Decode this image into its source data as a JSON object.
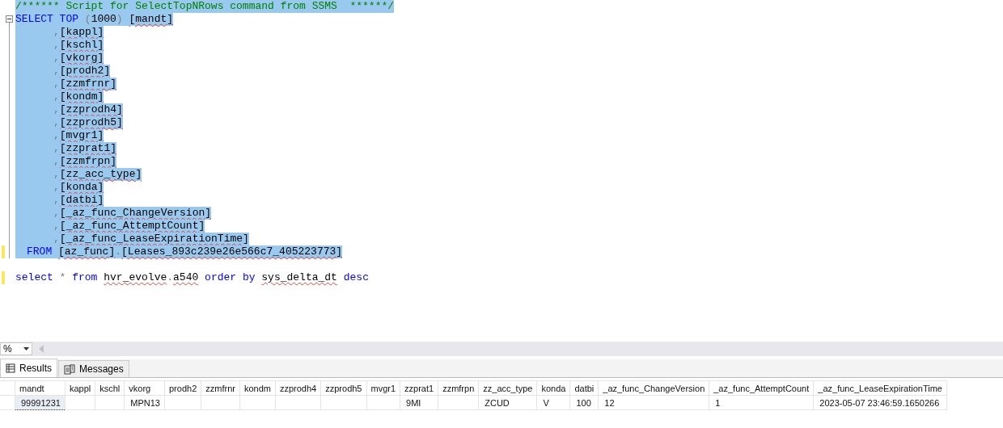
{
  "editor": {
    "lines": [
      {
        "kind": "code",
        "selected": true,
        "segments": [
          {
            "kind": "comment",
            "text": "/****** Script for SelectTopNRows command from SSMS  ******/"
          }
        ]
      },
      {
        "kind": "code",
        "selected": true,
        "collapsible": true,
        "segments": [
          {
            "kind": "keyword",
            "text": "SELECT "
          },
          {
            "kind": "keyword",
            "text": "TOP"
          },
          {
            "kind": "gray",
            "text": " ("
          },
          {
            "kind": "plain",
            "text": "1000"
          },
          {
            "kind": "gray",
            "text": ") "
          },
          {
            "kind": "plain",
            "text": "[mandt]",
            "squiggle": true
          }
        ]
      },
      {
        "kind": "column",
        "selected": true,
        "segments": [
          {
            "kind": "gray",
            "text": ","
          },
          {
            "kind": "plain",
            "text": "[kappl]",
            "squiggle": true
          }
        ]
      },
      {
        "kind": "column",
        "selected": true,
        "segments": [
          {
            "kind": "gray",
            "text": ","
          },
          {
            "kind": "plain",
            "text": "[kschl]",
            "squiggle": true
          }
        ]
      },
      {
        "kind": "column",
        "selected": true,
        "segments": [
          {
            "kind": "gray",
            "text": ","
          },
          {
            "kind": "plain",
            "text": "[vkorg]",
            "squiggle": true
          }
        ]
      },
      {
        "kind": "column",
        "selected": true,
        "segments": [
          {
            "kind": "gray",
            "text": ","
          },
          {
            "kind": "plain",
            "text": "[prodh2]",
            "squiggle": true
          }
        ]
      },
      {
        "kind": "column",
        "selected": true,
        "segments": [
          {
            "kind": "gray",
            "text": ","
          },
          {
            "kind": "plain",
            "text": "[zzmfrnr]",
            "squiggle": true
          }
        ]
      },
      {
        "kind": "column",
        "selected": true,
        "segments": [
          {
            "kind": "gray",
            "text": ","
          },
          {
            "kind": "plain",
            "text": "[kondm]",
            "squiggle": true
          }
        ]
      },
      {
        "kind": "column",
        "selected": true,
        "segments": [
          {
            "kind": "gray",
            "text": ","
          },
          {
            "kind": "plain",
            "text": "[zzprodh4]",
            "squiggle": true
          }
        ]
      },
      {
        "kind": "column",
        "selected": true,
        "segments": [
          {
            "kind": "gray",
            "text": ","
          },
          {
            "kind": "plain",
            "text": "[zzprodh5]",
            "squiggle": true
          }
        ]
      },
      {
        "kind": "column",
        "selected": true,
        "segments": [
          {
            "kind": "gray",
            "text": ","
          },
          {
            "kind": "plain",
            "text": "[mvgr1]",
            "squiggle": true
          }
        ]
      },
      {
        "kind": "column",
        "selected": true,
        "segments": [
          {
            "kind": "gray",
            "text": ","
          },
          {
            "kind": "plain",
            "text": "[zzprat1]",
            "squiggle": true
          }
        ]
      },
      {
        "kind": "column",
        "selected": true,
        "segments": [
          {
            "kind": "gray",
            "text": ","
          },
          {
            "kind": "plain",
            "text": "[zzmfrpn]",
            "squiggle": true
          }
        ]
      },
      {
        "kind": "column",
        "selected": true,
        "segments": [
          {
            "kind": "gray",
            "text": ","
          },
          {
            "kind": "plain",
            "text": "[zz_acc_type]",
            "squiggle": true
          }
        ]
      },
      {
        "kind": "column",
        "selected": true,
        "segments": [
          {
            "kind": "gray",
            "text": ","
          },
          {
            "kind": "plain",
            "text": "[konda]",
            "squiggle": true
          }
        ]
      },
      {
        "kind": "column",
        "selected": true,
        "segments": [
          {
            "kind": "gray",
            "text": ","
          },
          {
            "kind": "plain",
            "text": "[datbi]",
            "squiggle": true
          }
        ]
      },
      {
        "kind": "column",
        "selected": true,
        "segments": [
          {
            "kind": "gray",
            "text": ","
          },
          {
            "kind": "plain",
            "text": "[_az_func_ChangeVersion]",
            "squiggle": true
          }
        ]
      },
      {
        "kind": "column",
        "selected": true,
        "segments": [
          {
            "kind": "gray",
            "text": ","
          },
          {
            "kind": "plain",
            "text": "[_az_func_AttemptCount]",
            "squiggle": true
          }
        ]
      },
      {
        "kind": "column",
        "selected": true,
        "segments": [
          {
            "kind": "gray",
            "text": ","
          },
          {
            "kind": "plain",
            "text": "[_az_func_LeaseExpirationTime]",
            "squiggle": true
          }
        ]
      },
      {
        "kind": "from",
        "selected": true,
        "changed": true,
        "segments": [
          {
            "kind": "keyword",
            "text": "FROM "
          },
          {
            "kind": "plain",
            "text": "[az_func]",
            "squiggle": true
          },
          {
            "kind": "gray",
            "text": "."
          },
          {
            "kind": "plain",
            "text": "[Leases_893c239e26e566c7_405223773]",
            "squiggle": true
          }
        ]
      },
      {
        "kind": "blank"
      },
      {
        "kind": "code",
        "selected": false,
        "changed": true,
        "segments": [
          {
            "kind": "keyword",
            "text": "select"
          },
          {
            "kind": "gray",
            "text": " * "
          },
          {
            "kind": "keyword",
            "text": "from "
          },
          {
            "kind": "plain",
            "text": "hvr_evolve",
            "squiggle": true
          },
          {
            "kind": "gray",
            "text": "."
          },
          {
            "kind": "plain",
            "text": "a540",
            "squiggle": true
          },
          {
            "kind": "keyword",
            "text": " order by "
          },
          {
            "kind": "plain",
            "text": "sys_delta_dt",
            "squiggle": true
          },
          {
            "kind": "keyword",
            "text": " desc"
          }
        ]
      }
    ]
  },
  "zoom": {
    "value": "%"
  },
  "tabs": [
    {
      "label": "Results",
      "selected": true
    },
    {
      "label": "Messages",
      "selected": false
    }
  ],
  "grid": {
    "columns": [
      "mandt",
      "kappl",
      "kschl",
      "vkorg",
      "prodh2",
      "zzmfrnr",
      "kondm",
      "zzprodh4",
      "zzprodh5",
      "mvgr1",
      "zzprat1",
      "zzmfrpn",
      "zz_acc_type",
      "konda",
      "datbi",
      "_az_func_ChangeVersion",
      "_az_func_AttemptCount",
      "_az_func_LeaseExpirationTime"
    ],
    "rows": [
      {
        "cells": [
          {
            "text": "99991231",
            "selected": true
          },
          {
            "selected": false
          },
          {
            "selected": false
          },
          {
            "text": "MPN13",
            "selected": false
          },
          {
            "selected": false
          },
          {
            "selected": false
          },
          {
            "selected": false
          },
          {
            "selected": false
          },
          {
            "selected": false
          },
          {
            "selected": false
          },
          {
            "text": "9MI",
            "selected": false
          },
          {
            "selected": false
          },
          {
            "text": "ZCUD",
            "selected": false
          },
          {
            "text": "V",
            "selected": false
          },
          {
            "text": "100",
            "selected": false
          },
          {
            "text": "12",
            "selected": false
          },
          {
            "text": "1",
            "selected": false
          },
          {
            "text": "2023-05-07 23:46:59.1650266",
            "selected": false
          }
        ]
      }
    ]
  }
}
